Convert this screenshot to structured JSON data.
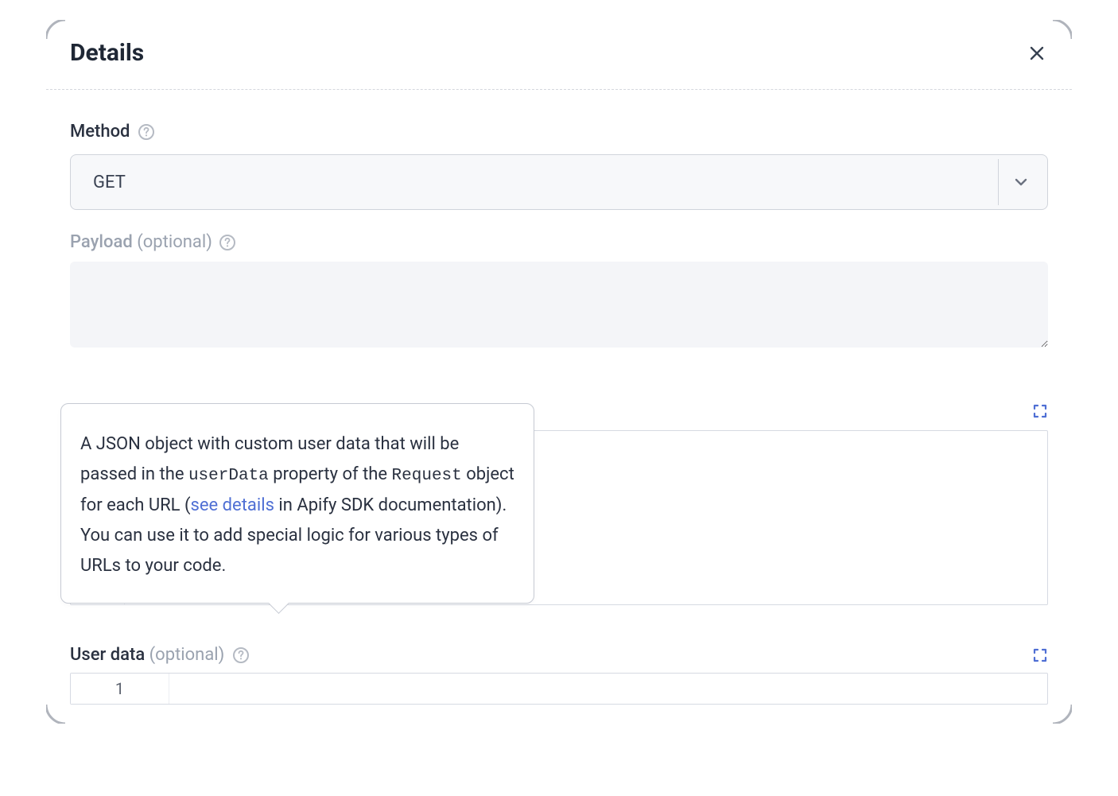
{
  "header": {
    "title": "Details"
  },
  "method": {
    "label": "Method",
    "value": "GET"
  },
  "payload": {
    "label": "Payload",
    "optional": "(optional)",
    "value": ""
  },
  "tooltip": {
    "text1": "A JSON object with custom user data that will be passed in the ",
    "code1": "userData",
    "text2": " property of the ",
    "code2": "Request",
    "text3": " object for each URL (",
    "link": "see details",
    "text4": " in Apify SDK documentation). You can use it to add special logic for various types of URLs to your code."
  },
  "userData": {
    "label": "User data",
    "optional": "(optional)",
    "lineNumber": "1"
  }
}
